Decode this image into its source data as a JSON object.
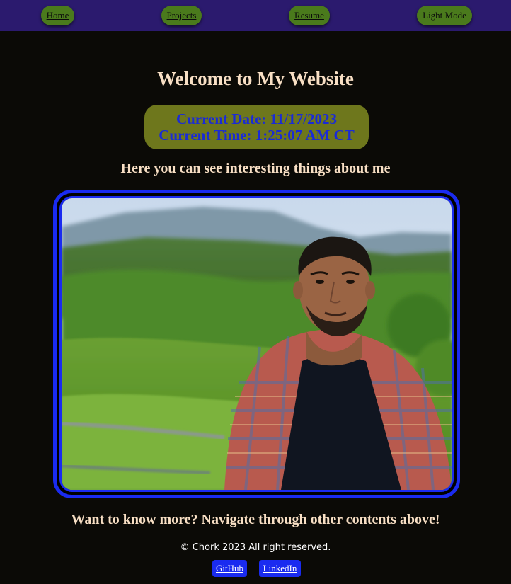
{
  "nav": {
    "home": "Home",
    "projects": "Projects",
    "resume": "Resume",
    "light_mode": "Light Mode"
  },
  "main": {
    "title": "Welcome to My Website",
    "date_line": "Current Date: 11/17/2023",
    "time_line": "Current Time: 1:25:07 AM CT",
    "subtitle": "Here you can see interesting things about me",
    "cta": "Want to know more? Navigate through other contents above!"
  },
  "footer": {
    "copyright": "© Chork 2023 All right reserved.",
    "github": "GitHub",
    "linkedin": "LinkedIn"
  },
  "colors": {
    "nav_bg": "#2b1a6e",
    "nav_button": "#4a7a1c",
    "page_bg": "#0b0a06",
    "heading_text": "#f8dfc4",
    "accent_blue": "#1a2bf0",
    "datetime_box": "#6e771c"
  }
}
